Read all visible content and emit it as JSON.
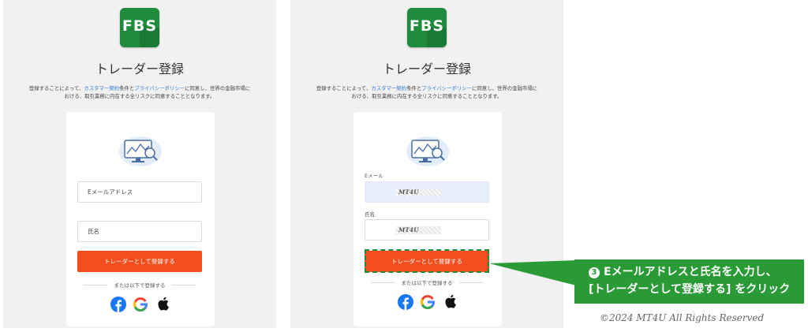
{
  "brand": {
    "logo_text": "FBS",
    "color": "#1e8b3d"
  },
  "accent_color": "#f24e1e",
  "page_title": "トレーダー登録",
  "terms": {
    "prefix": "登録することによって、",
    "customer_agreement_link": "カスタマー契約",
    "middle": "条件と",
    "privacy_link": "プライバシーポリシー",
    "suffix_line1": "に同意し、世界の金融市場に",
    "line2": "おける、取引業務に内在する全リスクに同意することとなります。"
  },
  "left_form": {
    "email_placeholder": "Eメールアドレス",
    "name_placeholder": "氏名",
    "register_button": "トレーダーとして登録する",
    "or_text": "または以下で登録する"
  },
  "right_form": {
    "email_label": "Eメール",
    "email_value": "MT4U",
    "name_label": "氏名",
    "name_value": "MT4U",
    "register_button": "トレーダーとして登録する",
    "or_text": "または以下で登録する"
  },
  "social_icons": [
    "facebook-icon",
    "google-icon",
    "apple-icon"
  ],
  "callout": {
    "step_number": "3",
    "line1": "Eメールアドレスと氏名を入力し、",
    "line2": "[トレーダーとして登録する] をクリック",
    "color": "#2a9a36"
  },
  "copyright": "©2024 MT4U All Rights Reserved"
}
